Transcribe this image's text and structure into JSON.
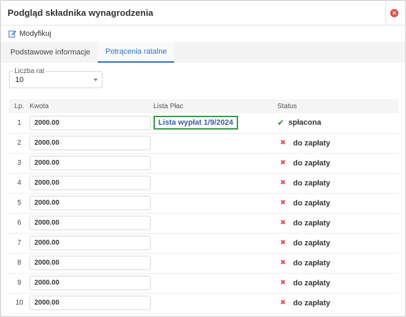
{
  "window": {
    "title": "Podgląd składnika wynagrodzenia"
  },
  "toolbar": {
    "modify_label": "Modyfikuj"
  },
  "tabs": [
    {
      "label": "Podstawowe informacje",
      "active": false
    },
    {
      "label": "Potrącenia ratalne",
      "active": true
    }
  ],
  "installments": {
    "legend": "Liczba rat",
    "value": "10"
  },
  "table": {
    "headers": {
      "lp": "Lp.",
      "kwota": "Kwota",
      "lista": "Lista Płac",
      "status": "Status"
    },
    "rows": [
      {
        "lp": "1",
        "kwota": "2000.00",
        "lista": "Lista wypłat 1/9/2024",
        "status": "spłacona",
        "status_icon": "check-icon"
      },
      {
        "lp": "2",
        "kwota": "2000.00",
        "lista": "",
        "status": "do zapłaty",
        "status_icon": "x-icon"
      },
      {
        "lp": "3",
        "kwota": "2000.00",
        "lista": "",
        "status": "do zapłaty",
        "status_icon": "x-icon"
      },
      {
        "lp": "4",
        "kwota": "2000.00",
        "lista": "",
        "status": "do zapłaty",
        "status_icon": "x-icon"
      },
      {
        "lp": "5",
        "kwota": "2000.00",
        "lista": "",
        "status": "do zapłaty",
        "status_icon": "x-icon"
      },
      {
        "lp": "6",
        "kwota": "2000.00",
        "lista": "",
        "status": "do zapłaty",
        "status_icon": "x-icon"
      },
      {
        "lp": "7",
        "kwota": "2000.00",
        "lista": "",
        "status": "do zapłaty",
        "status_icon": "x-icon"
      },
      {
        "lp": "8",
        "kwota": "2000.00",
        "lista": "",
        "status": "do zapłaty",
        "status_icon": "x-icon"
      },
      {
        "lp": "9",
        "kwota": "2000.00",
        "lista": "",
        "status": "do zapłaty",
        "status_icon": "x-icon"
      },
      {
        "lp": "10",
        "kwota": "2000.00",
        "lista": "",
        "status": "do zapłaty",
        "status_icon": "x-icon"
      }
    ]
  },
  "colors": {
    "accent": "#2a6fc0",
    "ok": "#2e8b3a",
    "danger": "#d9534f",
    "link_border": "#2ea043"
  }
}
